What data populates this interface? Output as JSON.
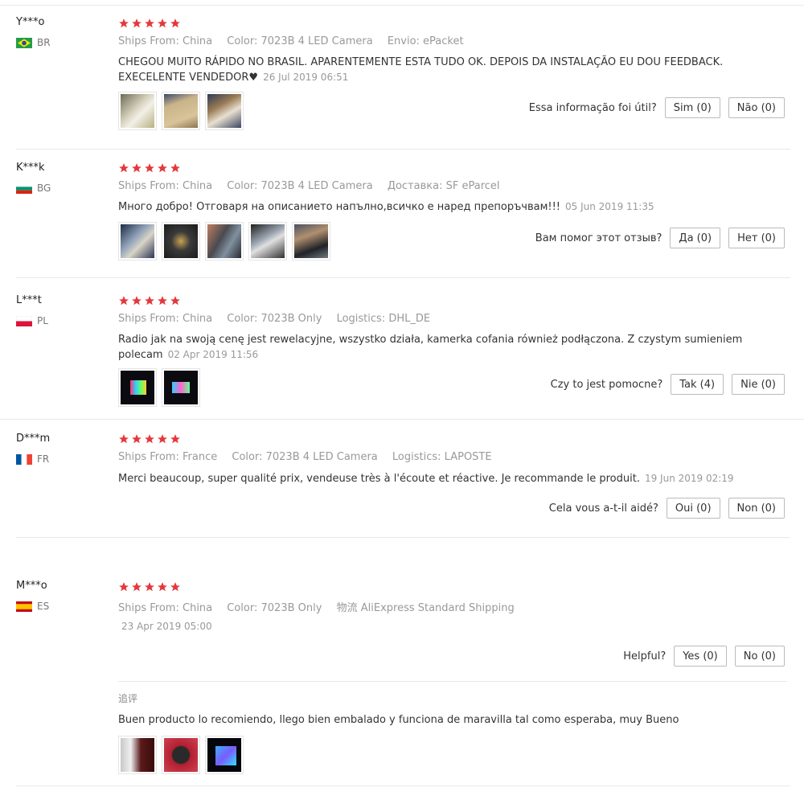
{
  "reviews": [
    {
      "user": "Y***o",
      "country": "BR",
      "rating": 5,
      "ships_from_label": "Ships From:",
      "ships_from": "China",
      "color_label": "Color:",
      "color": "7023B 4 LED Camera",
      "logistics_label": "Envio:",
      "logistics": "ePacket",
      "text_line1": "CHEGOU MUITO RÁPIDO NO BRASIL. APARENTEMENTE ESTA TUDO OK. DEPOIS DA INSTALAÇÃO EU DOU FEEDBACK.",
      "text_line2": "EXECELENTE VENDEDOR♥",
      "date": "26 Jul 2019 06:51",
      "helpful_prompt": "Essa informação foi útil?",
      "yes_label": "Sim (0)",
      "no_label": "Não (0)"
    },
    {
      "user": "K***k",
      "country": "BG",
      "rating": 5,
      "ships_from_label": "Ships From:",
      "ships_from": "China",
      "color_label": "Color:",
      "color": "7023B 4 LED Camera",
      "logistics_label": "Доставка:",
      "logistics": "SF eParcel",
      "text_line1": "Много добро! Отговаря на описанието напълно,всичко е наред препоръчвам!!!",
      "date": "05 Jun 2019 11:35",
      "helpful_prompt": "Вам помог этот отзыв?",
      "yes_label": "Да (0)",
      "no_label": "Нет (0)"
    },
    {
      "user": "L***t",
      "country": "PL",
      "rating": 5,
      "ships_from_label": "Ships From:",
      "ships_from": "China",
      "color_label": "Color:",
      "color": "7023B Only",
      "logistics_label": "Logistics:",
      "logistics": "DHL_DE",
      "text_line1": "Radio jak na swoją cenę jest rewelacyjne, wszystko działa, kamerka cofania również podłączona. Z czystym sumieniem",
      "text_line2": "polecam",
      "date": "02 Apr 2019 11:56",
      "helpful_prompt": "Czy to jest pomocne?",
      "yes_label": "Tak (4)",
      "no_label": "Nie (0)"
    },
    {
      "user": "D***m",
      "country": "FR",
      "rating": 5,
      "ships_from_label": "Ships From:",
      "ships_from": "France",
      "color_label": "Color:",
      "color": "7023B 4 LED Camera",
      "logistics_label": "Logistics:",
      "logistics": "LAPOSTE",
      "text_line1": "Merci beaucoup, super qualité prix, vendeuse très à l'écoute et réactive. Je recommande le produit.",
      "date": "19 Jun 2019 02:19",
      "helpful_prompt": "Cela vous a-t-il aidé?",
      "yes_label": "Oui (0)",
      "no_label": "Non (0)"
    },
    {
      "user": "M***o",
      "country": "ES",
      "rating": 5,
      "ships_from_label": "Ships From:",
      "ships_from": "China",
      "color_label": "Color:",
      "color": "7023B Only",
      "logistics_label": "物流",
      "logistics": "AliExpress Standard Shipping",
      "date": "23 Apr 2019 05:00",
      "helpful_prompt": "Helpful?",
      "yes_label": "Yes (0)",
      "no_label": "No (0)",
      "followup_label": "追评",
      "followup_text": "Buen producto lo recomiendo, llego bien embalado y funciona de maravilla tal como esperaba, muy Bueno"
    }
  ],
  "colors": {
    "star": "#e4393c",
    "meta_text": "#999999",
    "border": "#e8e8e8"
  }
}
